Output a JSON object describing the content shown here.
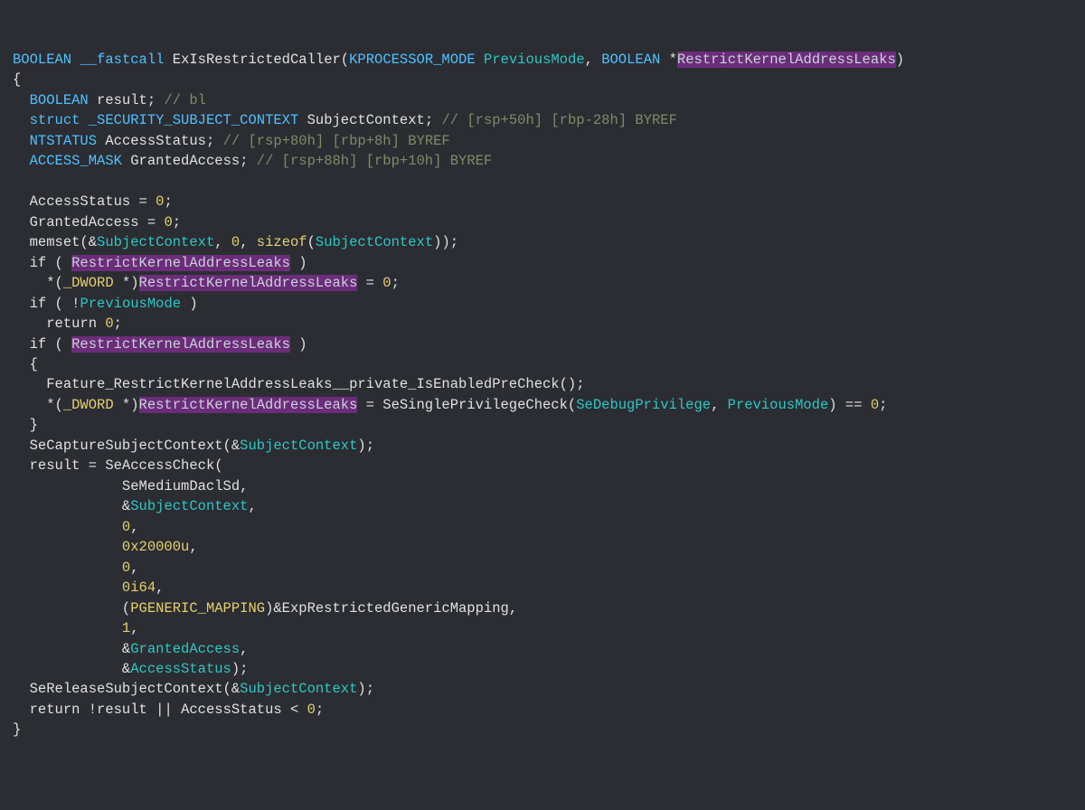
{
  "sig": {
    "ret": "BOOLEAN",
    "cc": "__fastcall",
    "name": "ExIsRestrictedCaller",
    "p1type": "KPROCESSOR_MODE",
    "p1name": "PreviousMode",
    "p2type": "BOOLEAN",
    "p2name": "RestrictKernelAddressLeaks"
  },
  "decl": {
    "d1t": "BOOLEAN",
    "d1n": "result",
    "d1c": "// bl",
    "d2t": "struct",
    "d2t2": "_SECURITY_SUBJECT_CONTEXT",
    "d2n": "SubjectContext",
    "d2c": "// [rsp+50h] [rbp-28h] BYREF",
    "d3t": "NTSTATUS",
    "d3n": "AccessStatus",
    "d3c": "// [rsp+80h] [rbp+8h] BYREF",
    "d4t": "ACCESS_MASK",
    "d4n": "GrantedAccess",
    "d4c": "// [rsp+88h] [rbp+10h] BYREF"
  },
  "body": {
    "asgn1l": "AccessStatus",
    "zero": "0",
    "asgn2l": "GrantedAccess",
    "memset": "memset",
    "sizeof": "sizeof",
    "subj": "SubjectContext",
    "if_kw": "if",
    "ret_kw": "return",
    "rkal": "RestrictKernelAddressLeaks",
    "dword": "_DWORD",
    "pmode": "PreviousMode",
    "feat": "Feature_RestrictKernelAddressLeaks__private_IsEnabledPreCheck",
    "priv": "SeSinglePrivilegeCheck",
    "dbg": "SeDebugPrivilege",
    "cap": "SeCaptureSubjectContext",
    "res": "result",
    "acc": "SeAccessCheck",
    "arg1": "SeMediumDaclSd",
    "arg2": "SubjectContext",
    "a3": "0",
    "a4": "0x20000u",
    "a5": "0",
    "a6": "0i64",
    "pmap": "PGENERIC_MAPPING",
    "expmap": "ExpRestrictedGenericMapping",
    "a8": "1",
    "a9": "GrantedAccess",
    "a10": "AccessStatus",
    "rel": "SeReleaseSubjectContext",
    "final_res": "result",
    "final_as": "AccessStatus"
  }
}
